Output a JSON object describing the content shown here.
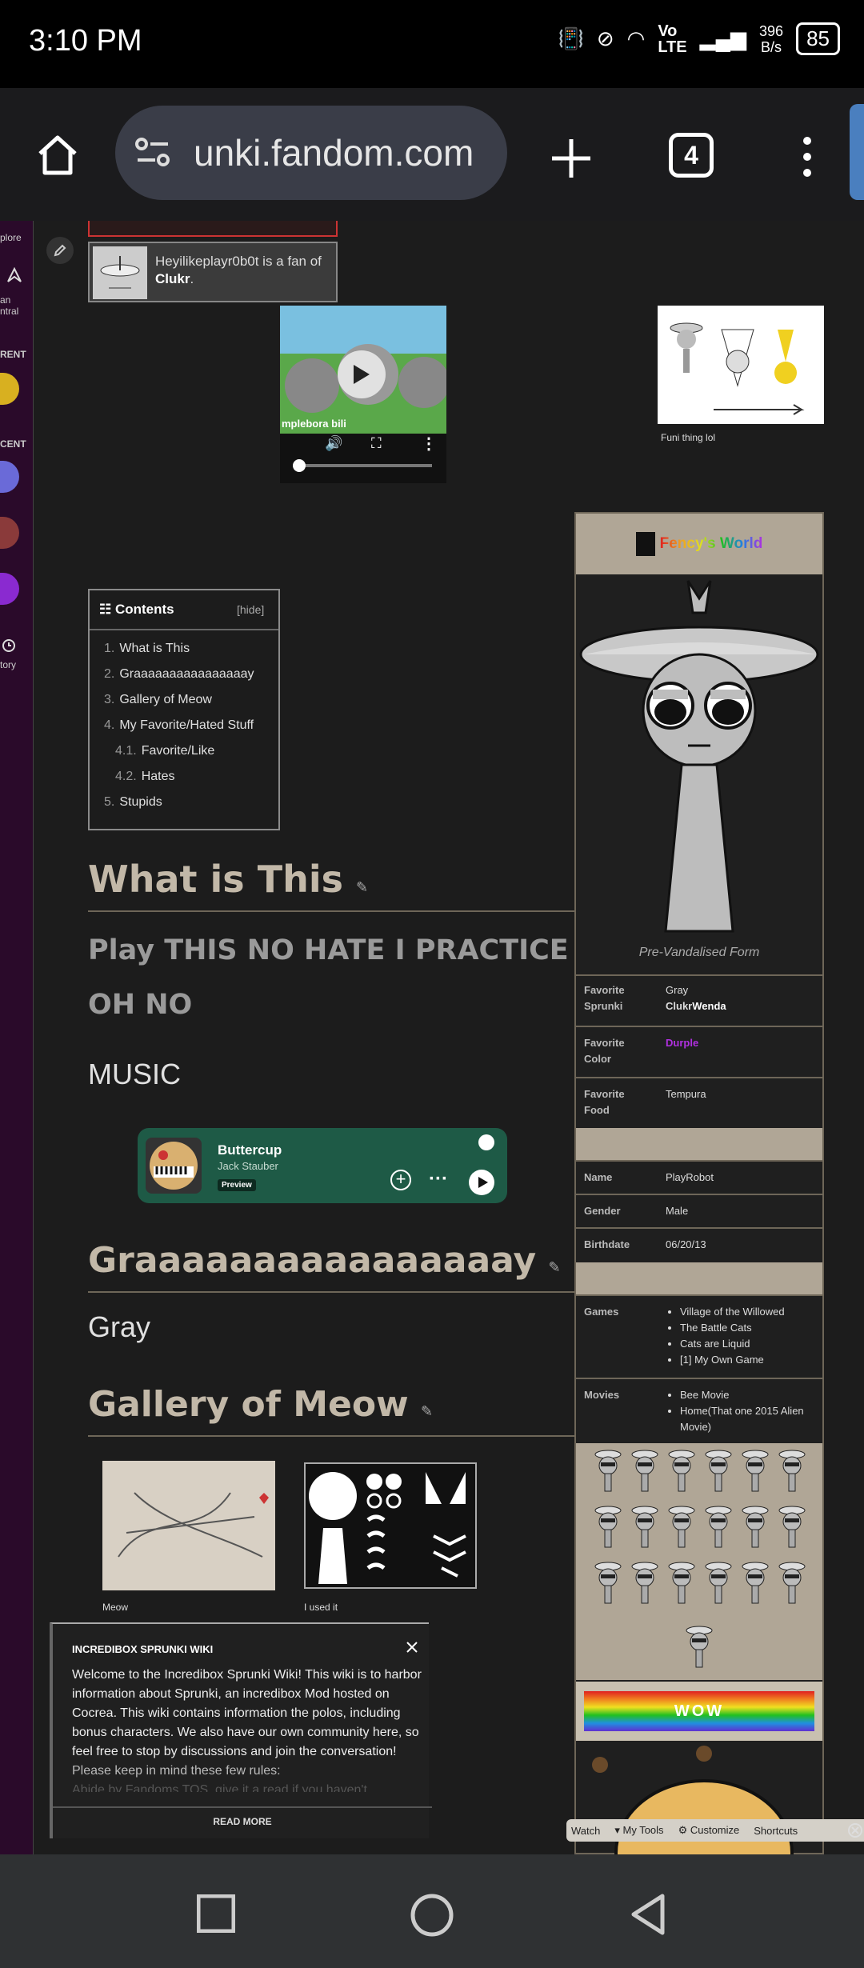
{
  "status_bar": {
    "time": "3:10 PM",
    "speed": "396\nB/s",
    "battery": "85",
    "network": "Vo\nLTE"
  },
  "browser": {
    "url": "unki.fandom.com",
    "tab_count": "4"
  },
  "rail": {
    "labels": [
      "plore",
      "an\nntral",
      "RENT",
      "CENT",
      "tory"
    ]
  },
  "activity": {
    "text_prefix": "Heyilikeplayr0b0t is a fan of ",
    "text_bold": "Clukr",
    "text_suffix": "."
  },
  "video": {
    "overlay_text": "mplebora bili"
  },
  "thumb": {
    "caption": "Funi thing lol"
  },
  "toc": {
    "title": "Contents",
    "hide": "[hide]",
    "items": [
      {
        "num": "1.",
        "label": "What is This"
      },
      {
        "num": "2.",
        "label": "Graaaaaaaaaaaaaaaay"
      },
      {
        "num": "3.",
        "label": "Gallery of Meow"
      },
      {
        "num": "4.",
        "label": "My Favorite/Hated Stuff"
      },
      {
        "num": "4.1.",
        "label": "Favorite/Like"
      },
      {
        "num": "4.2.",
        "label": "Hates"
      },
      {
        "num": "5.",
        "label": "Stupids"
      }
    ]
  },
  "sections": {
    "what_is_this": "What is This",
    "play_text": "Play THIS NO HATE I PRACTICE OH NO",
    "music": "MUSIC",
    "gray_heading": "Graaaaaaaaaaaaaaaay",
    "gray_text": "Gray",
    "gallery_heading": "Gallery of Meow"
  },
  "spotify": {
    "title": "Buttercup",
    "artist": "Jack Stauber",
    "badge": "Preview"
  },
  "gallery": [
    {
      "caption": "Meow"
    },
    {
      "caption": "I used it"
    }
  ],
  "infobox": {
    "banner": "Fency's World",
    "image_caption": "Pre-Vandalised Form",
    "favorite_sprunki_key": "Favorite Sprunki",
    "favorite_sprunki_val1": "Gray",
    "favorite_sprunki_val2a": "Clukr",
    "favorite_sprunki_val2b": "Wenda",
    "favorite_color_key": "Favorite Color",
    "favorite_color_val": "Durple",
    "favorite_food_key": "Favorite Food",
    "favorite_food_val": "Tempura",
    "name_key": "Name",
    "name_val": "PlayRobot",
    "gender_key": "Gender",
    "gender_val": "Male",
    "birthdate_key": "Birthdate",
    "birthdate_val": "06/20/13",
    "games_key": "Games",
    "games": [
      "Village of the Willowed",
      "The Battle Cats",
      "Cats are Liquid",
      "[1] My Own Game"
    ],
    "movies_key": "Movies",
    "movies": [
      "Bee Movie",
      "Home(That one 2015 Alien Movie)"
    ],
    "wow": "WOW"
  },
  "notice": {
    "title": "INCREDIBOX SPRUNKI WIKI",
    "body": "Welcome to the Incredibox Sprunki Wiki! This wiki is to harbor information about Sprunki, an incredibox Mod hosted on Cocrea. This wiki contains information the polos, including bonus characters. We also have our own community here, so feel free to stop by discussions and join the conversation!",
    "rules": "Please keep in mind these few rules:",
    "faded": "Abide by Fandoms TOS, give it a read if you haven't",
    "read_more": "READ MORE"
  },
  "toolbar": {
    "watch": "Watch",
    "my_tools": "My Tools",
    "customize": "Customize",
    "shortcuts": "Shortcuts"
  },
  "colors": {
    "heading": "#c2b8a8",
    "purple": "#b030e0",
    "spotify": "#1e5a46"
  }
}
